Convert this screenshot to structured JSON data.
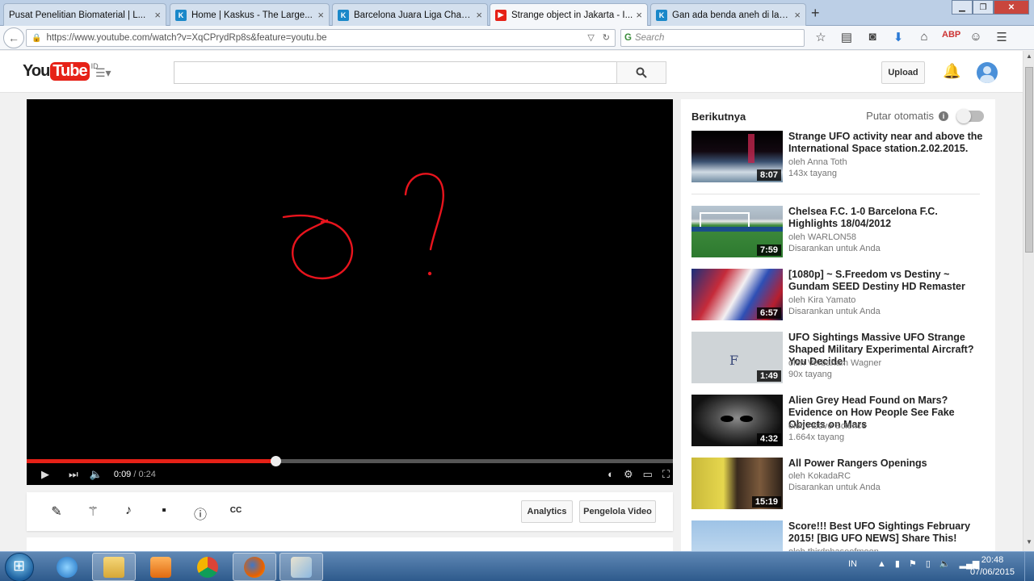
{
  "browser": {
    "tabs": [
      {
        "label": "Pusat Penelitian Biomaterial | L...",
        "favicon": "generic"
      },
      {
        "label": "Home | Kaskus - The Large...",
        "favicon": "kaskus"
      },
      {
        "label": "Barcelona Juara Liga Cham...",
        "favicon": "kaskus"
      },
      {
        "label": "Strange object in Jakarta - I...",
        "favicon": "youtube",
        "active": true
      },
      {
        "label": "Gan ada benda aneh di lan...",
        "favicon": "kaskus"
      }
    ],
    "url": "https://www.youtube.com/watch?v=XqCPrydRp8s&feature=youtu.be",
    "search_placeholder": "Search",
    "kaskus_favicon_glyph": "K",
    "youtube_favicon_glyph": "▶"
  },
  "youtube": {
    "logo_you": "You",
    "logo_tube": "Tube",
    "logo_country": "ID",
    "upload_label": "Upload",
    "accent": "#e62117"
  },
  "player": {
    "current_time": "0:09",
    "duration": "/ 0:24",
    "progress_fraction": 0.385
  },
  "actions": {
    "analytics_label": "Analytics",
    "manager_label": "Pengelola Video"
  },
  "sidebar": {
    "heading": "Berikutnya",
    "autoplay_label": "Putar otomatis",
    "videos": [
      {
        "title": "Strange UFO activity near and above the International Space station.2.02.2015.",
        "channel": "oleh Anna Toth",
        "meta": "143x tayang",
        "duration": "8:07"
      },
      {
        "title": "Chelsea F.C. 1-0 Barcelona F.C. Highlights 18/04/2012",
        "channel": "oleh WARLON58",
        "meta": "Disarankan untuk Anda",
        "duration": "7:59"
      },
      {
        "title": "[1080p] ~ S.Freedom vs Destiny ~ Gundam SEED Destiny HD Remaster",
        "channel": "oleh Kira Yamato",
        "meta": "Disarankan untuk Anda",
        "duration": "6:57"
      },
      {
        "title": "UFO Sightings Massive UFO Strange Shaped Military Experimental Aircraft? You Decide!",
        "channel": "oleh Verbaham Wagner",
        "meta": "90x tayang",
        "duration": "1:49"
      },
      {
        "title": "Alien Grey Head Found on Mars? Evidence on How People See Fake Objects on Mars",
        "channel": "oleh Above Science",
        "meta": "1.664x tayang",
        "duration": "4:32"
      },
      {
        "title": "All Power Rangers Openings",
        "channel": "oleh KokadaRC",
        "meta": "Disarankan untuk Anda",
        "duration": "15:19"
      },
      {
        "title": "Score!!! Best UFO Sightings February 2015! [BIG UFO NEWS] Share This!",
        "channel": "oleh thirdphaseofmoon",
        "meta": "",
        "duration": ""
      }
    ]
  },
  "taskbar": {
    "language": "IN",
    "time": "20:48",
    "date": "07/06/2015"
  }
}
